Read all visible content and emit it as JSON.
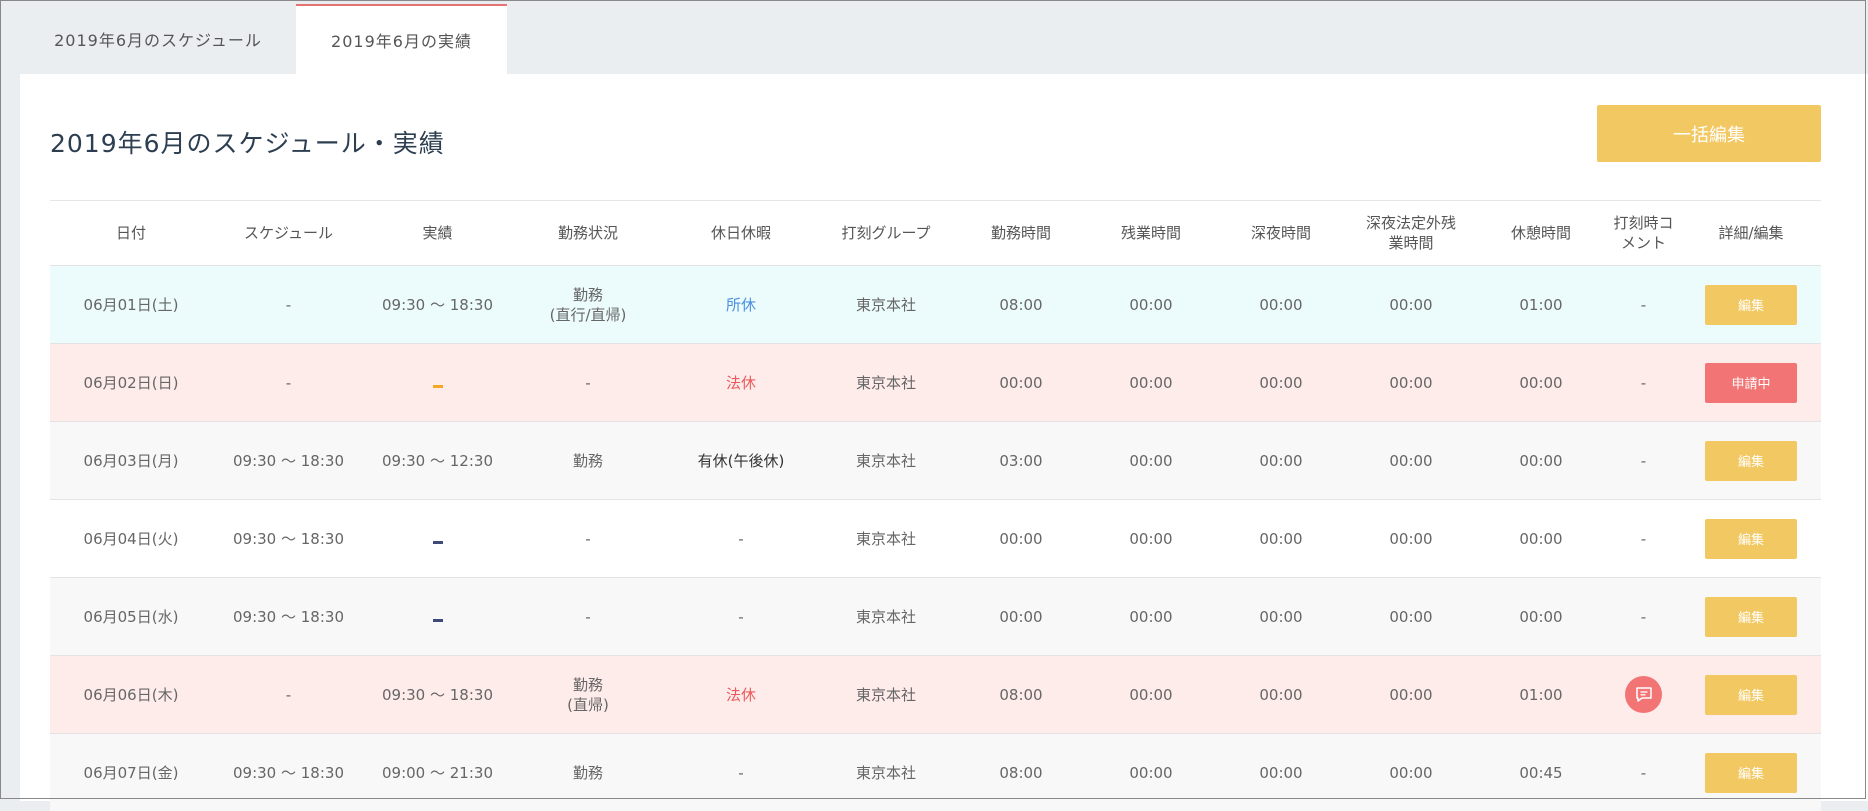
{
  "tabs": [
    {
      "label": "2019年6月のスケジュール"
    },
    {
      "label": "2019年6月の実績"
    }
  ],
  "page": {
    "title": "2019年6月のスケジュール・実績",
    "bulk_edit_label": "一括編集"
  },
  "table": {
    "headers": [
      "日付",
      "スケジュール",
      "実績",
      "勤務状況",
      "休日休暇",
      "打刻グループ",
      "勤務時間",
      "残業時間",
      "深夜時間",
      "深夜法定外残業時間",
      "休憩時間",
      "打刻時コメント",
      "詳細/編集"
    ],
    "rows": [
      {
        "date": "06月01日(土)",
        "schedule": "-",
        "actual": "09:30 ～ 18:30",
        "status_l1": "勤務",
        "status_l2": "(直行/直帰)",
        "holiday": "所休",
        "group": "東京本社",
        "work": "08:00",
        "overtime": "00:00",
        "night": "00:00",
        "night_ot": "00:00",
        "break": "01:00",
        "comment": "-",
        "action": "編集"
      },
      {
        "date": "06月02日(日)",
        "schedule": "-",
        "actual": "",
        "status_l1": "-",
        "status_l2": "",
        "holiday": "法休",
        "group": "東京本社",
        "work": "00:00",
        "overtime": "00:00",
        "night": "00:00",
        "night_ot": "00:00",
        "break": "00:00",
        "comment": "-",
        "action": "申請中"
      },
      {
        "date": "06月03日(月)",
        "schedule": "09:30 ～ 18:30",
        "actual": "09:30 ～ 12:30",
        "status_l1": "勤務",
        "status_l2": "",
        "holiday": "有休(午後休)",
        "group": "東京本社",
        "work": "03:00",
        "overtime": "00:00",
        "night": "00:00",
        "night_ot": "00:00",
        "break": "00:00",
        "comment": "-",
        "action": "編集"
      },
      {
        "date": "06月04日(火)",
        "schedule": "09:30 ～ 18:30",
        "actual": "",
        "status_l1": "-",
        "status_l2": "",
        "holiday": "-",
        "group": "東京本社",
        "work": "00:00",
        "overtime": "00:00",
        "night": "00:00",
        "night_ot": "00:00",
        "break": "00:00",
        "comment": "-",
        "action": "編集"
      },
      {
        "date": "06月05日(水)",
        "schedule": "09:30 ～ 18:30",
        "actual": "",
        "status_l1": "-",
        "status_l2": "",
        "holiday": "-",
        "group": "東京本社",
        "work": "00:00",
        "overtime": "00:00",
        "night": "00:00",
        "night_ot": "00:00",
        "break": "00:00",
        "comment": "-",
        "action": "編集"
      },
      {
        "date": "06月06日(木)",
        "schedule": "-",
        "actual": "09:30 ～ 18:30",
        "status_l1": "勤務",
        "status_l2": "(直帰)",
        "holiday": "法休",
        "group": "東京本社",
        "work": "08:00",
        "overtime": "00:00",
        "night": "00:00",
        "night_ot": "00:00",
        "break": "01:00",
        "comment": "",
        "action": "編集"
      },
      {
        "date": "06月07日(金)",
        "schedule": "09:30 ～ 18:30",
        "actual": "09:00 ～ 21:30",
        "status_l1": "勤務",
        "status_l2": "",
        "holiday": "-",
        "group": "東京本社",
        "work": "08:00",
        "overtime": "00:00",
        "night": "00:00",
        "night_ot": "00:00",
        "break": "00:45",
        "comment": "-",
        "action": "編集"
      }
    ]
  },
  "colors": {
    "accent": "#f2c862",
    "pending": "#f27474",
    "statutory_holiday": "#e95b5b",
    "company_holiday": "#4a90e2"
  },
  "icons": {
    "comment": "chat-bubble-icon"
  }
}
